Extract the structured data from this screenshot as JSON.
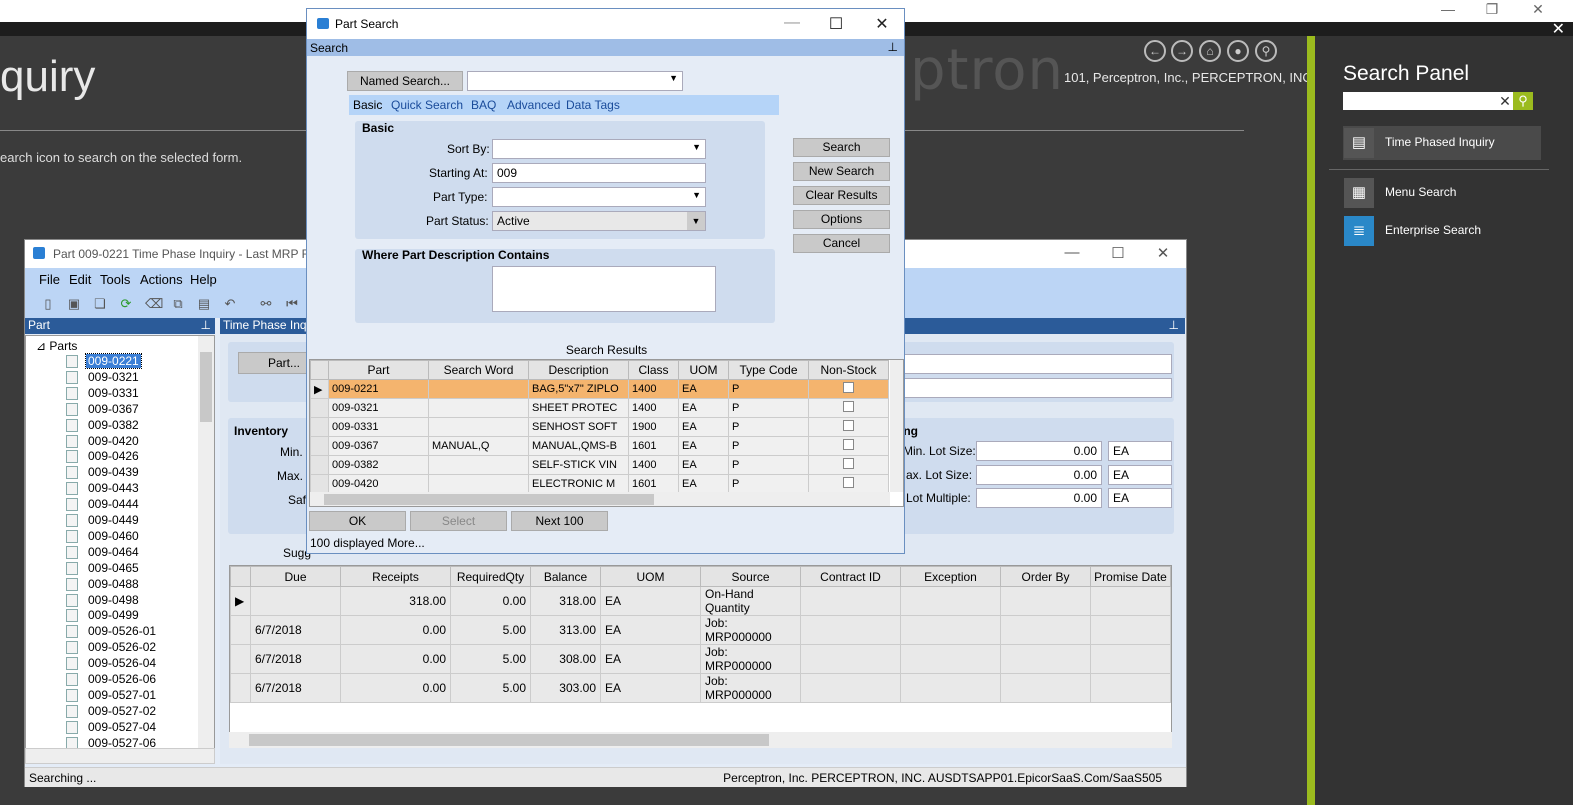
{
  "background": {
    "title_fragment": "quiry",
    "logo_fragment": "ptron",
    "company": "101, Perceptron, Inc., PERCEPTRON, INC.",
    "hint": "earch icon to search on the selected form."
  },
  "search_panel": {
    "title": "Search Panel",
    "input_value": "",
    "items": [
      {
        "label": "Time Phased Inquiry",
        "icon": "time-phased-inquiry-icon"
      },
      {
        "label": "Menu Search",
        "icon": "grid-icon"
      },
      {
        "label": "Enterprise Search",
        "icon": "database-icon"
      }
    ]
  },
  "window": {
    "title": "Part 009-0221 Time Phase Inquiry  - Last MRP RU",
    "menus": [
      "File",
      "Edit",
      "Tools",
      "Actions",
      "Help"
    ],
    "left_panel_title": "Part",
    "right_panel_title": "Time Phase Inqu",
    "tree_root": "Parts",
    "tree_items": [
      "009-0221",
      "009-0321",
      "009-0331",
      "009-0367",
      "009-0382",
      "009-0420",
      "009-0426",
      "009-0439",
      "009-0443",
      "009-0444",
      "009-0449",
      "009-0460",
      "009-0464",
      "009-0465",
      "009-0488",
      "009-0498",
      "009-0499",
      "009-0526-01",
      "009-0526-02",
      "009-0526-04",
      "009-0526-06",
      "009-0527-01",
      "009-0527-02",
      "009-0527-04",
      "009-0527-06"
    ],
    "part_button": "Part...",
    "inventory_label": "Inventory",
    "min_label": "Min.",
    "max_label": "Max.",
    "saf_label": "Saf",
    "sugg_label": "Sugg",
    "ing_label": "ing",
    "min_lot_label": "Min. Lot Size:",
    "max_lot_label": "ax. Lot Size:",
    "lot_multiple_label": "Lot Multiple:",
    "min_lot_value": "0.00",
    "max_lot_value": "0.00",
    "lot_multiple_value": "0.00",
    "uom1": "EA",
    "uom2": "EA",
    "uom3": "EA",
    "grid_headers": [
      "Due",
      "Receipts",
      "RequiredQty",
      "Balance",
      "UOM",
      "Source",
      "Contract ID",
      "Exception",
      "Order By",
      "Promise Date"
    ],
    "grid_rows": [
      [
        "",
        "318.00",
        "0.00",
        "318.00",
        "EA",
        "On-Hand Quantity",
        "",
        "",
        "",
        ""
      ],
      [
        "6/7/2018",
        "0.00",
        "5.00",
        "313.00",
        "EA",
        "Job: MRP000000",
        "",
        "",
        "",
        ""
      ],
      [
        "6/7/2018",
        "0.00",
        "5.00",
        "308.00",
        "EA",
        "Job: MRP000000",
        "",
        "",
        "",
        ""
      ],
      [
        "6/7/2018",
        "0.00",
        "5.00",
        "303.00",
        "EA",
        "Job: MRP000000",
        "",
        "",
        "",
        ""
      ]
    ],
    "status_left": "Searching ...",
    "status_right": "Perceptron, Inc.  PERCEPTRON, INC.    AUSDTSAPP01.EpicorSaaS.Com/SaaS505"
  },
  "dialog": {
    "title": "Part Search",
    "subheader": "Search",
    "named_search_button": "Named Search...",
    "named_search_value": "",
    "tabs": [
      "Basic",
      "Quick Search",
      "BAQ",
      "Advanced",
      "Data Tags"
    ],
    "basic_group": "Basic",
    "sort_by_label": "Sort By:",
    "sort_by_value": "",
    "starting_at_label": "Starting At:",
    "starting_at_value": "009",
    "part_type_label": "Part Type:",
    "part_type_value": "",
    "part_status_label": "Part Status:",
    "part_status_value": "Active",
    "desc_group": "Where Part Description Contains",
    "desc_value": "",
    "buttons": {
      "search": "Search",
      "new_search": "New Search",
      "clear_results": "Clear Results",
      "options": "Options",
      "cancel": "Cancel"
    },
    "results_title": "Search Results",
    "result_headers": [
      "Part",
      "Search Word",
      "Description",
      "Class",
      "UOM",
      "Type Code",
      "Non-Stock"
    ],
    "result_rows": [
      [
        "009-0221",
        "",
        "BAG,5\"x7\" ZIPLO",
        "1400",
        "EA",
        "P"
      ],
      [
        "009-0321",
        "",
        "SHEET PROTEC",
        "1400",
        "EA",
        "P"
      ],
      [
        "009-0331",
        "",
        "SENHOST SOFT",
        "1900",
        "EA",
        "P"
      ],
      [
        "009-0367",
        "MANUAL,Q",
        "MANUAL,QMS-B",
        "1601",
        "EA",
        "P"
      ],
      [
        "009-0382",
        "",
        "SELF-STICK VIN",
        "1400",
        "EA",
        "P"
      ],
      [
        "009-0420",
        "",
        "ELECTRONIC M",
        "1601",
        "EA",
        "P"
      ]
    ],
    "ok_button": "OK",
    "select_button": "Select",
    "next_button": "Next 100",
    "footer": "100 displayed More..."
  }
}
